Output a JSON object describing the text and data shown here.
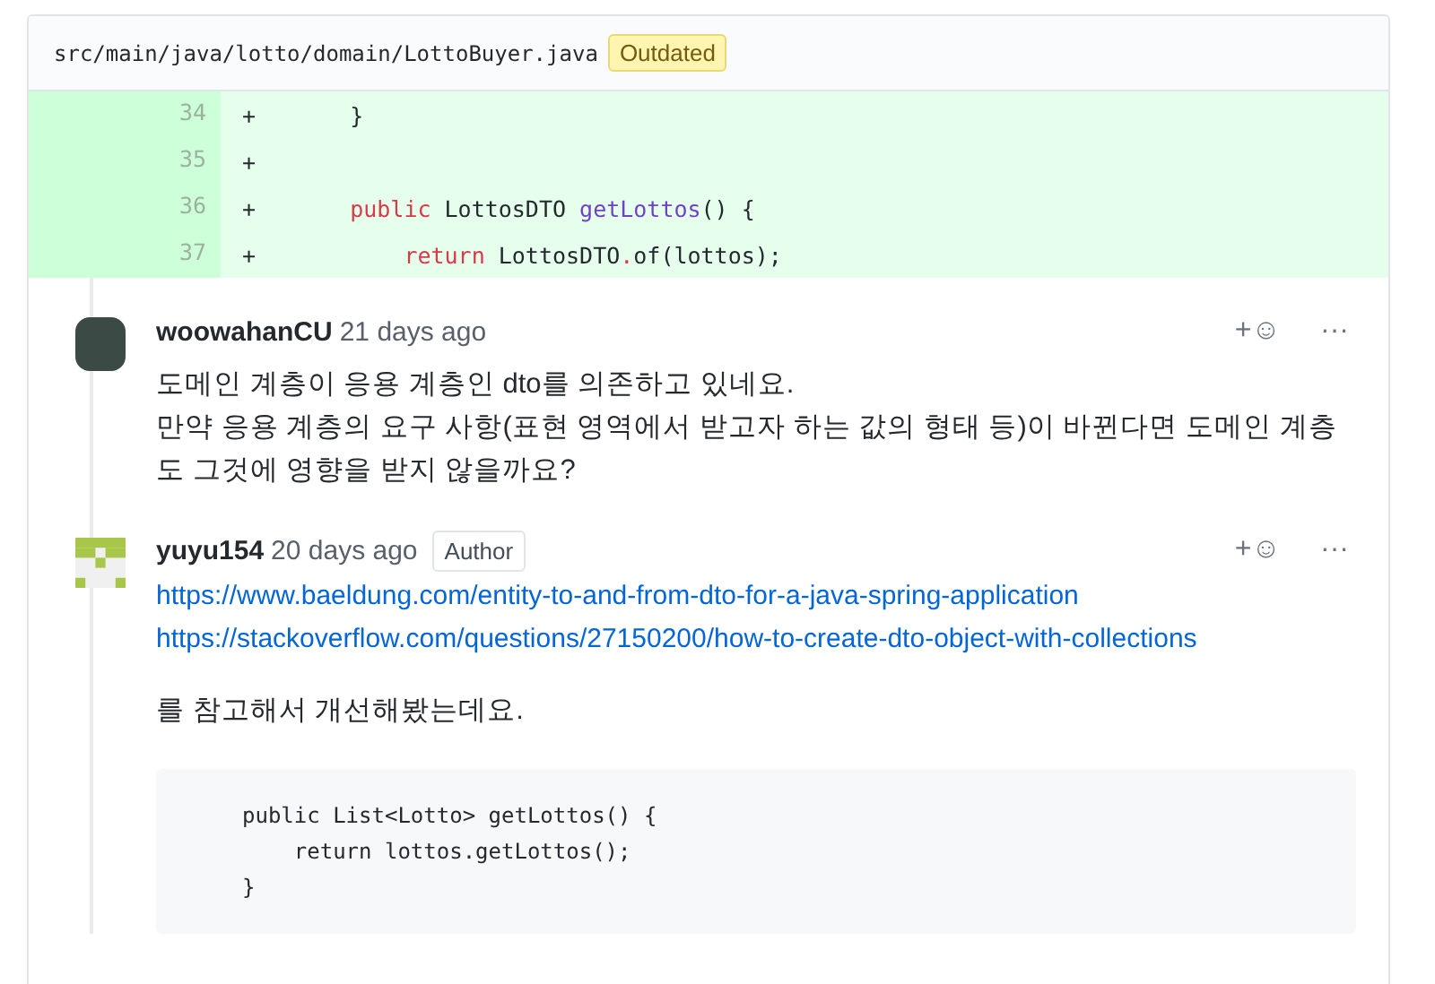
{
  "file_header": {
    "path": "src/main/java/lotto/domain/LottoBuyer.java",
    "badge": "Outdated"
  },
  "diff_lines": [
    {
      "number": "34",
      "sign": "+",
      "kind": "member",
      "tokens": [
        {
          "text": "}",
          "kind": "plain"
        }
      ]
    },
    {
      "number": "35",
      "sign": "+",
      "kind": "member"
    },
    {
      "number": "36",
      "sign": "+",
      "kind": "member",
      "tokens": [
        {
          "text": "public",
          "kind": "keyword"
        },
        {
          "text": " LottosDTO ",
          "kind": "plain"
        },
        {
          "text": "getLottos",
          "kind": "function"
        },
        {
          "text": "() {",
          "kind": "plain"
        }
      ]
    },
    {
      "number": "37",
      "sign": "+",
      "kind": "body",
      "tokens": [
        {
          "text": "return",
          "kind": "keyword"
        },
        {
          "text": " LottosDTO",
          "kind": "plain"
        },
        {
          "text": ".",
          "kind": "keyword"
        },
        {
          "text": "of(lottos);",
          "kind": "plain"
        }
      ]
    }
  ],
  "comments": [
    {
      "author": "woowahanCU",
      "time": "21 days ago",
      "kind": "photo",
      "reaction": "+☺",
      "menu": "···",
      "body": [
        {
          "kind": "text",
          "text": "도메인 계층이 응용 계층인 dto를 의존하고 있네요.\n만약 응용 계층의 요구 사항(표현 영역에서 받고자 하는 값의 형태 등)이 바뀐다면 도메인 계층도 그것에 영향을 받지 않을까요?"
        }
      ]
    },
    {
      "author": "yuyu154",
      "time": "20 days ago",
      "badge": "Author",
      "kind": "identicon",
      "reaction": "+☺",
      "menu": "···",
      "body": [
        {
          "kind": "link",
          "text": "https://www.baeldung.com/entity-to-and-from-dto-for-a-java-spring-application"
        },
        {
          "kind": "link",
          "text": "https://stackoverflow.com/questions/27150200/how-to-create-dto-object-with-collections"
        },
        {
          "kind": "text",
          "text": "를 참고해서 개선해봤는데요."
        },
        {
          "kind": "code",
          "text": "public List<Lotto> getLottos() {\n    return lottos.getLottos();\n}"
        }
      ]
    }
  ]
}
